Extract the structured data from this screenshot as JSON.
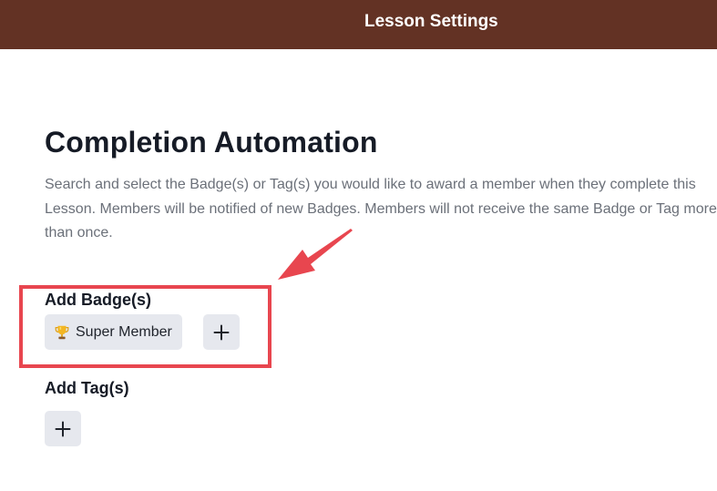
{
  "header": {
    "title": "Lesson Settings"
  },
  "section": {
    "title": "Completion Automation",
    "description": "Search and select the Badge(s) or Tag(s) you would like to award a member when they complete this Lesson. Members will be notified of new Badges. Members will not receive the same Badge or Tag more than once."
  },
  "badges": {
    "label": "Add Badge(s)",
    "items": [
      {
        "label": "Super Member",
        "icon": "trophy-icon"
      }
    ],
    "add_icon": "plus-icon"
  },
  "tags": {
    "label": "Add Tag(s)",
    "add_icon": "plus-icon"
  },
  "colors": {
    "header_bg": "#633224",
    "annotation": "#e8464f",
    "chip_bg": "#e6e8ee",
    "heading_text": "#161b26",
    "body_text": "#6b7079"
  }
}
